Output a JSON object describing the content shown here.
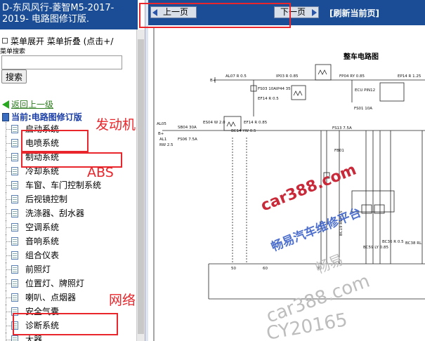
{
  "sidebar": {
    "title": "D-东风风行-菱智M5-2017-2019- 电路图修订版.",
    "toggle": "菜单展开 菜单折叠 (点击+/",
    "search_label": "菜单搜索",
    "search_value": "",
    "search_button": "搜索",
    "back_link": "返回上一级",
    "current": "当前:电路图修订版",
    "items": [
      {
        "label": "启动系统"
      },
      {
        "label": "电喷系统"
      },
      {
        "label": "制动系统"
      },
      {
        "label": "冷却系统"
      },
      {
        "label": "车窗、车门控制系统"
      },
      {
        "label": "后视镜控制"
      },
      {
        "label": "洗涤器、刮水器"
      },
      {
        "label": "空调系统"
      },
      {
        "label": "音响系统"
      },
      {
        "label": "组合仪表"
      },
      {
        "label": "前照灯"
      },
      {
        "label": "位置灯、牌照灯"
      },
      {
        "label": "喇叭、点烟器"
      },
      {
        "label": "安全气囊"
      },
      {
        "label": "诊断系统"
      },
      {
        "label": "大器"
      }
    ]
  },
  "toolbar": {
    "prev": "上一页",
    "next": "下一页",
    "refresh": "[刷新当前页]"
  },
  "diagram": {
    "title": "整车电路图",
    "labels": {
      "b_plus_1": "B+",
      "b_plus_2": "B+",
      "al07": "AL07 R 0.5",
      "ip03": "IP03 R 0.85",
      "fp04": "FP04 RY 0.85",
      "ep14": "EP14 R 1.25",
      "fs03": "FS03 10A",
      "ip44": "IP44 35",
      "ef14": "EF14 R 0.5",
      "ecu_pin12": "ECU PIN12",
      "fs01": "FS01 10A",
      "al05": "AL05",
      "sb04": "SB04 30A",
      "es04": "ES04 W 2.0",
      "ef14b": "EF14 R 0.85",
      "bc14": "BC14 YW 0.5",
      "fs13": "FS13 7.5A",
      "fs06": "FS06 7.5A",
      "al1": "AL1",
      "rw25": "RW 2.5",
      "fb01": "FB01",
      "bc19": "BC19 RW 0.5",
      "bc59": "BC59 LY 0.85",
      "bc36": "BC36 R 0.5",
      "bc38": "BC38 RL",
      "n50": "50",
      "n60": "60",
      "n30": "30"
    }
  },
  "watermarks": {
    "main": "car388.com",
    "platform": "畅易汽车维修平台",
    "ghost1": "畅易",
    "ghost2": "car388.com",
    "ghost3": "CY20165"
  },
  "annotations": {
    "engine": "发动机",
    "abs": "ABS",
    "network": "网络"
  },
  "colors": {
    "header_blue": "#1b4d96",
    "annotation_red": "#e8262b",
    "watermark_red": "#c92a3a",
    "watermark_blue": "#3c62c8"
  }
}
